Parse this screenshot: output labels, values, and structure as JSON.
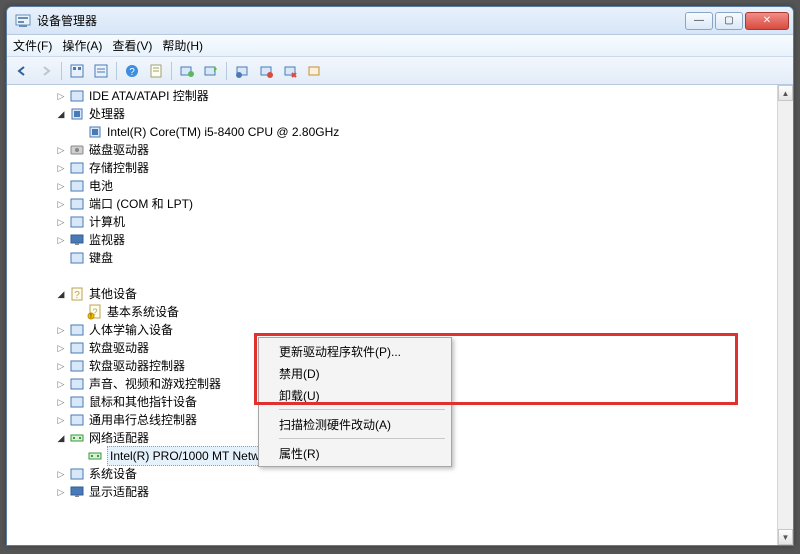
{
  "titlebar": {
    "title": "设备管理器",
    "min": "—",
    "max": "▢",
    "close": "✕"
  },
  "menu": {
    "file": "文件(F)",
    "action": "操作(A)",
    "view": "查看(V)",
    "help": "帮助(H)"
  },
  "toolbar_icons": [
    "back-icon",
    "forward-icon",
    "show-hidden-icon",
    "refresh-icon",
    "help-icon",
    "properties-icon",
    "scan-icon",
    "scan-hw-icon",
    "add-legacy-icon",
    "update-driver-icon",
    "uninstall-icon"
  ],
  "tree": [
    {
      "d": 2,
      "exp": "c",
      "icon": "ide-icon",
      "label": "IDE ATA/ATAPI 控制器"
    },
    {
      "d": 2,
      "exp": "o",
      "icon": "cpu-icon",
      "label": "处理器"
    },
    {
      "d": 3,
      "exp": "",
      "icon": "cpu-icon",
      "label": "Intel(R) Core(TM) i5-8400 CPU @ 2.80GHz"
    },
    {
      "d": 2,
      "exp": "c",
      "icon": "disk-icon",
      "label": "磁盘驱动器"
    },
    {
      "d": 2,
      "exp": "c",
      "icon": "storage-icon",
      "label": "存储控制器"
    },
    {
      "d": 2,
      "exp": "c",
      "icon": "battery-icon",
      "label": "电池"
    },
    {
      "d": 2,
      "exp": "c",
      "icon": "port-icon",
      "label": "端口 (COM 和 LPT)"
    },
    {
      "d": 2,
      "exp": "c",
      "icon": "computer-icon",
      "label": "计算机"
    },
    {
      "d": 2,
      "exp": "c",
      "icon": "monitor-icon",
      "label": "监视器"
    },
    {
      "d": 2,
      "exp": "",
      "icon": "keyboard-icon",
      "label": "键盘"
    },
    {
      "d": 1,
      "exp": "",
      "icon": "blank",
      "label": ""
    },
    {
      "d": 2,
      "exp": "o",
      "icon": "other-icon",
      "label": "其他设备"
    },
    {
      "d": 3,
      "exp": "",
      "icon": "unknown-icon",
      "label": "基本系统设备"
    },
    {
      "d": 2,
      "exp": "c",
      "icon": "hid-icon",
      "label": "人体学输入设备"
    },
    {
      "d": 2,
      "exp": "c",
      "icon": "floppy-icon",
      "label": "软盘驱动器"
    },
    {
      "d": 2,
      "exp": "c",
      "icon": "floppyctrl-icon",
      "label": "软盘驱动器控制器"
    },
    {
      "d": 2,
      "exp": "c",
      "icon": "sound-icon",
      "label": "声音、视频和游戏控制器"
    },
    {
      "d": 2,
      "exp": "c",
      "icon": "mouse-icon",
      "label": "鼠标和其他指针设备"
    },
    {
      "d": 2,
      "exp": "c",
      "icon": "usb-icon",
      "label": "通用串行总线控制器"
    },
    {
      "d": 2,
      "exp": "o",
      "icon": "net-icon",
      "label": "网络适配器"
    },
    {
      "d": 3,
      "exp": "",
      "icon": "net-icon",
      "label": "Intel(R) PRO/1000 MT Network Connection",
      "sel": true
    },
    {
      "d": 2,
      "exp": "c",
      "icon": "system-icon",
      "label": "系统设备"
    },
    {
      "d": 2,
      "exp": "c",
      "icon": "display-icon",
      "label": "显示适配器"
    }
  ],
  "ctx": {
    "update": "更新驱动程序软件(P)...",
    "disable": "禁用(D)",
    "uninstall": "卸载(U)",
    "scan": "扫描检测硬件改动(A)",
    "prop": "属性(R)"
  }
}
